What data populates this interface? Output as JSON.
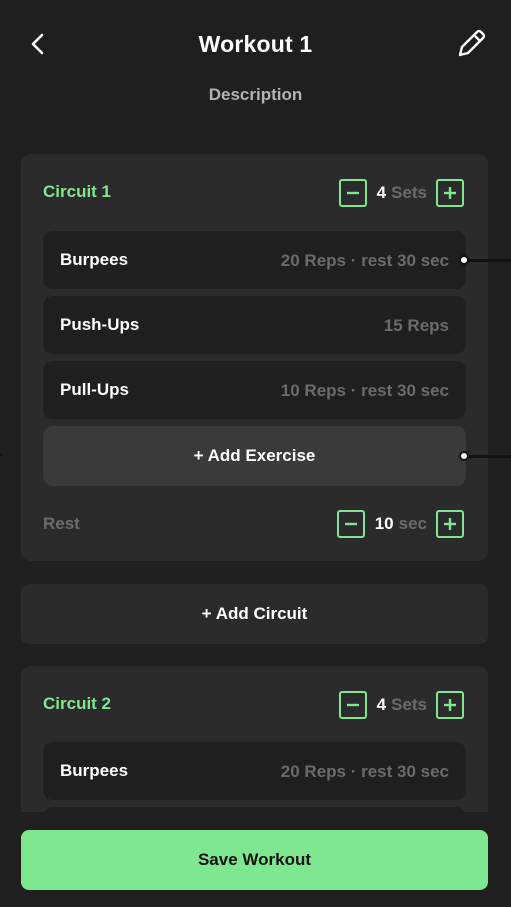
{
  "header": {
    "title": "Workout 1",
    "description": "Description",
    "back_icon": "chevron-left-icon",
    "edit_icon": "pencil-icon"
  },
  "circuits": [
    {
      "name": "Circuit 1",
      "sets_value": "4",
      "sets_unit": "Sets",
      "exercises": [
        {
          "name": "Burpees",
          "detail": "20 Reps · rest 30 sec"
        },
        {
          "name": "Push-Ups",
          "detail": "15 Reps"
        },
        {
          "name": "Pull-Ups",
          "detail": "10 Reps · rest 30 sec"
        }
      ],
      "add_exercise_label": "+ Add Exercise",
      "rest_label": "Rest",
      "rest_value": "10",
      "rest_unit": "sec"
    },
    {
      "name": "Circuit 2",
      "sets_value": "4",
      "sets_unit": "Sets",
      "exercises": [
        {
          "name": "Burpees",
          "detail": "20 Reps · rest 30 sec"
        }
      ]
    }
  ],
  "add_circuit_label": "+ Add Circuit",
  "save_label": "Save Workout",
  "colors": {
    "background": "#1f1f1f",
    "card": "#2b2b2b",
    "accent": "#7ee891",
    "muted_text": "#6b6b6b"
  }
}
